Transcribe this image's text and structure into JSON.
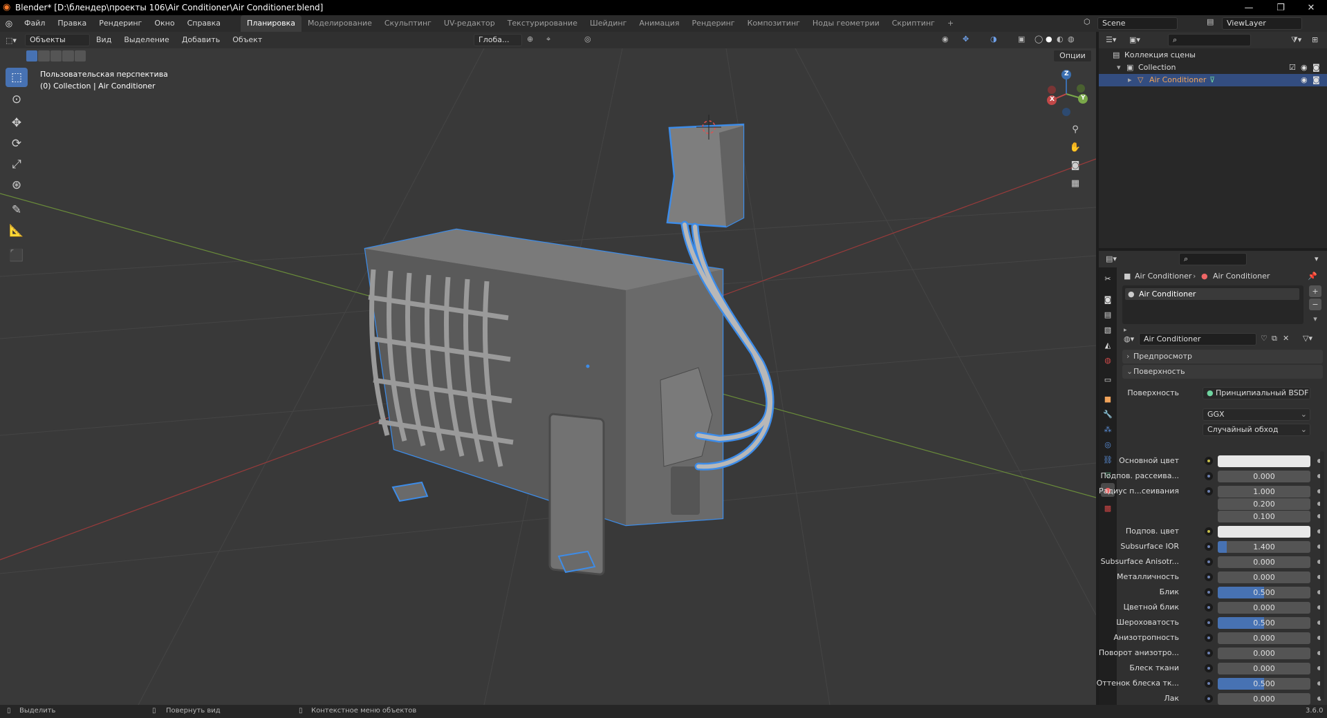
{
  "window": {
    "title": "Blender* [D:\\блендер\\проекты 106\\Air Conditioner\\Air Conditioner.blend]",
    "minimize": "—",
    "maximize": "❐",
    "close": "✕"
  },
  "menubar": {
    "items": [
      "Файл",
      "Правка",
      "Рендеринг",
      "Окно",
      "Справка"
    ]
  },
  "workspaces": [
    "Планировка",
    "Моделирование",
    "Скульптинг",
    "UV-редактор",
    "Текстурирование",
    "Шейдинг",
    "Анимация",
    "Рендеринг",
    "Композитинг",
    "Ноды геометрии",
    "Скриптинг",
    "+"
  ],
  "scene": {
    "name": "Scene",
    "viewlayer": "ViewLayer"
  },
  "viewport_header": {
    "mode": "Объекты",
    "menus": [
      "Вид",
      "Выделение",
      "Добавить",
      "Объект"
    ],
    "orientation": "Глоба...",
    "options": "Опции"
  },
  "viewport": {
    "perspective": "Пользовательская перспектива",
    "collection_info": "(0) Collection | Air Conditioner",
    "gizmo": {
      "x": "X",
      "y": "Y",
      "z": "Z"
    }
  },
  "outliner": {
    "rows": [
      {
        "label": "Коллекция сцены"
      },
      {
        "label": "Collection"
      },
      {
        "label": "Air Conditioner"
      }
    ]
  },
  "properties": {
    "breadcrumb": [
      "Air Conditioner",
      "Air Conditioner"
    ],
    "material_slot": "Air Conditioner",
    "material_name": "Air Conditioner",
    "panel_preview": "Предпросмотр",
    "panel_surface": "Поверхность",
    "surface_label": "Поверхность",
    "surface_value": "Принципиальный BSDF",
    "distribution": "GGX",
    "subsurface_method": "Случайный обход",
    "fields": [
      {
        "label": "Основной цвет",
        "value": "",
        "type": "color"
      },
      {
        "label": "Подпов. рассеива...",
        "value": "0.000",
        "fill": 0
      },
      {
        "label": "Радиус п...сеивания",
        "value": "1.000",
        "fill": 0
      },
      {
        "label": "",
        "value": "0.200",
        "fill": 0
      },
      {
        "label": "",
        "value": "0.100",
        "fill": 0
      },
      {
        "label": "Подпов. цвет",
        "value": "",
        "type": "color"
      },
      {
        "label": "Subsurface IOR",
        "value": "1.400",
        "fill": 0.1
      },
      {
        "label": "Subsurface Anisotr...",
        "value": "0.000",
        "fill": 0
      },
      {
        "label": "Металличность",
        "value": "0.000",
        "fill": 0
      },
      {
        "label": "Блик",
        "value": "0.500",
        "fill": 0.5
      },
      {
        "label": "Цветной блик",
        "value": "0.000",
        "fill": 0
      },
      {
        "label": "Шероховатость",
        "value": "0.500",
        "fill": 0.5
      },
      {
        "label": "Анизотропность",
        "value": "0.000",
        "fill": 0
      },
      {
        "label": "Поворот анизотро...",
        "value": "0.000",
        "fill": 0
      },
      {
        "label": "Блеск ткани",
        "value": "0.000",
        "fill": 0
      },
      {
        "label": "Оттенок блеска тк...",
        "value": "0.500",
        "fill": 0.5
      },
      {
        "label": "Лак",
        "value": "0.000",
        "fill": 0
      }
    ]
  },
  "statusbar": {
    "select": "Выделить",
    "rotate": "Повернуть вид",
    "context": "Контекстное меню объектов",
    "version": "3.6.0"
  }
}
